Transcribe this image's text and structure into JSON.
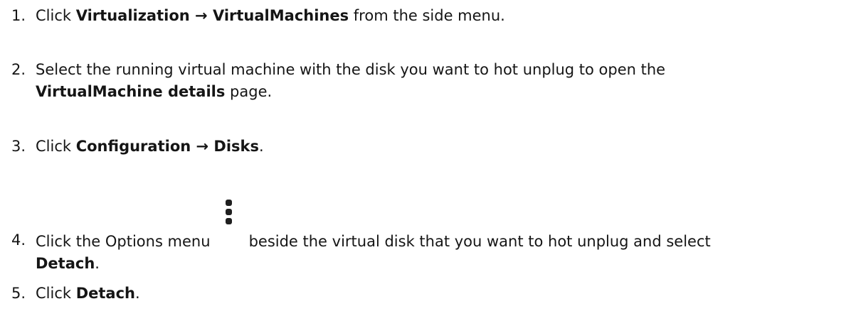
{
  "steps": [
    {
      "number": "1.",
      "prefix": "Click ",
      "bold_1": "Virtualization",
      "arrow": " → ",
      "bold_2": "VirtualMachines",
      "suffix": " from the side menu."
    },
    {
      "number": "2.",
      "line1": "Select the running virtual machine with the disk you want to hot unplug to open the",
      "bold": "VirtualMachine details",
      "suffix": " page."
    },
    {
      "number": "3.",
      "prefix": "Click ",
      "bold_1": "Configuration",
      "arrow": " → ",
      "bold_2": "Disks",
      "suffix": "."
    },
    {
      "number": "4.",
      "prefix": "Click the Options menu",
      "icon": "kebab-menu-icon",
      "middle": "beside the virtual disk that you want to hot unplug and select",
      "bold": "Detach",
      "suffix": "."
    },
    {
      "number": "5.",
      "prefix": "Click ",
      "bold": "Detach",
      "suffix": "."
    }
  ],
  "colors": {
    "text": "#151515",
    "icon": "#1f1f1f"
  }
}
